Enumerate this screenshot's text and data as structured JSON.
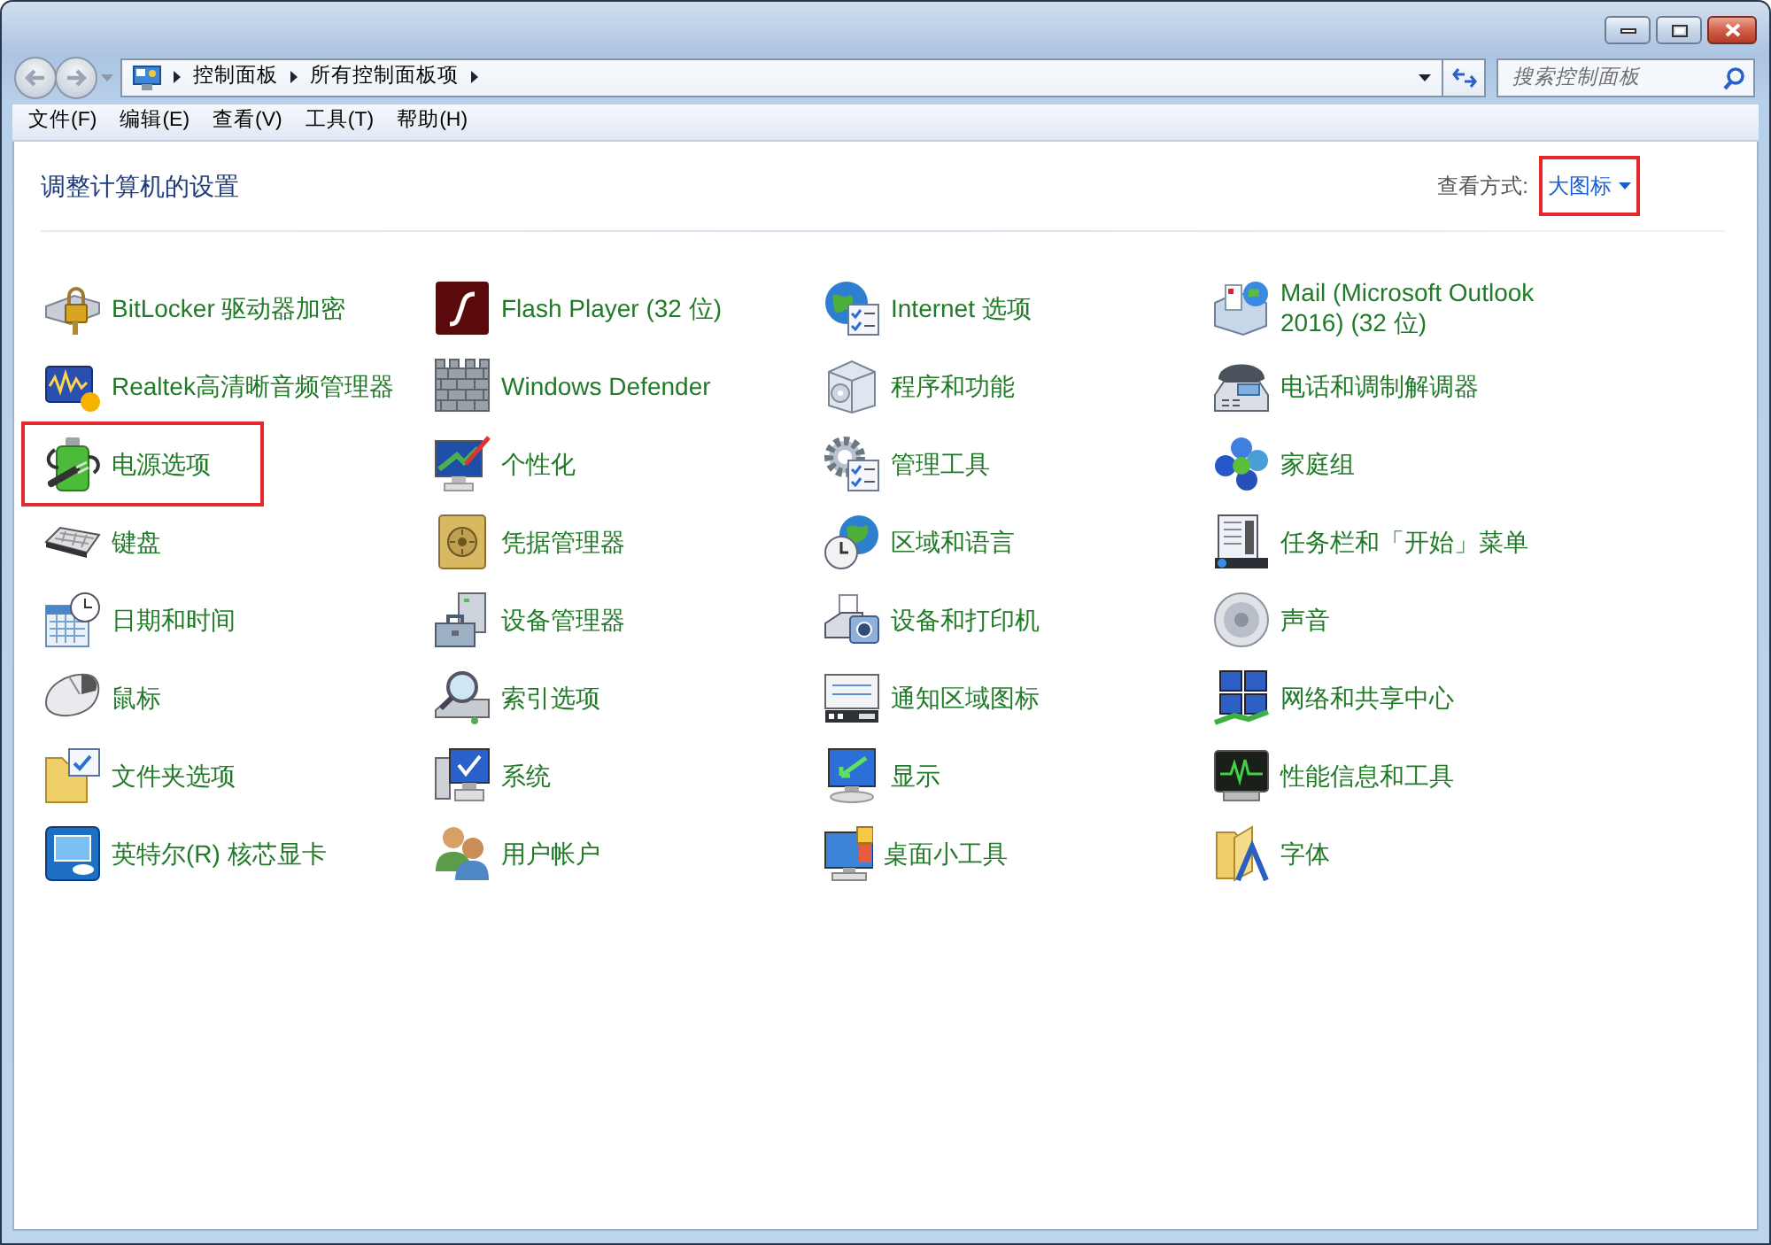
{
  "address_bar": {
    "breadcrumbs": [
      {
        "label": "控制面板"
      },
      {
        "label": "所有控制面板项"
      }
    ]
  },
  "search": {
    "placeholder": "搜索控制面板"
  },
  "menu_bar": [
    {
      "label": "文件(F)"
    },
    {
      "label": "编辑(E)"
    },
    {
      "label": "查看(V)"
    },
    {
      "label": "工具(T)"
    },
    {
      "label": "帮助(H)"
    }
  ],
  "header": {
    "title": "调整计算机的设置",
    "view_by_label": "查看方式:",
    "view_mode": {
      "label": "大图标",
      "highlighted": true
    }
  },
  "items": [
    {
      "label": "BitLocker 驱动器加密",
      "highlighted": false
    },
    {
      "label": "Flash Player (32 位)",
      "highlighted": false
    },
    {
      "label": "Internet 选项",
      "highlighted": false
    },
    {
      "label": "Mail (Microsoft Outlook 2016) (32 位)",
      "highlighted": false
    },
    {
      "label": "Realtek高清晰音频管理器",
      "highlighted": false
    },
    {
      "label": "Windows Defender",
      "highlighted": false
    },
    {
      "label": "程序和功能",
      "highlighted": false
    },
    {
      "label": "电话和调制解调器",
      "highlighted": false
    },
    {
      "label": "电源选项",
      "highlighted": true
    },
    {
      "label": "个性化",
      "highlighted": false
    },
    {
      "label": "管理工具",
      "highlighted": false
    },
    {
      "label": "家庭组",
      "highlighted": false
    },
    {
      "label": "键盘",
      "highlighted": false
    },
    {
      "label": "凭据管理器",
      "highlighted": false
    },
    {
      "label": "区域和语言",
      "highlighted": false
    },
    {
      "label": "任务栏和「开始」菜单",
      "highlighted": false
    },
    {
      "label": "日期和时间",
      "highlighted": false
    },
    {
      "label": "设备管理器",
      "highlighted": false
    },
    {
      "label": "设备和打印机",
      "highlighted": false
    },
    {
      "label": "声音",
      "highlighted": false
    },
    {
      "label": "鼠标",
      "highlighted": false
    },
    {
      "label": "索引选项",
      "highlighted": false
    },
    {
      "label": "通知区域图标",
      "highlighted": false
    },
    {
      "label": "网络和共享中心",
      "highlighted": false
    },
    {
      "label": "文件夹选项",
      "highlighted": false
    },
    {
      "label": "系统",
      "highlighted": false
    },
    {
      "label": "显示",
      "highlighted": false
    },
    {
      "label": "性能信息和工具",
      "highlighted": false
    },
    {
      "label": "英特尔(R) 核芯显卡",
      "highlighted": false
    },
    {
      "label": "用户帐户",
      "highlighted": false
    },
    {
      "label": "桌面小工具",
      "highlighted": false
    },
    {
      "label": "字体",
      "highlighted": false
    }
  ]
}
